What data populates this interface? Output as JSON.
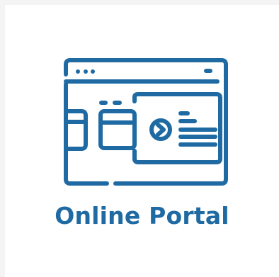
{
  "tile": {
    "label": "Online Portal",
    "icon": "online-portal-icon",
    "accent_color": "#1f6aa3"
  }
}
